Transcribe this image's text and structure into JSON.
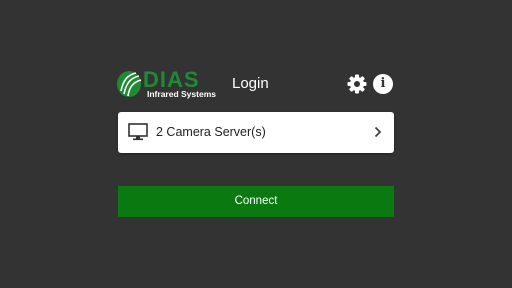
{
  "header": {
    "brand_name": "DIAS",
    "brand_tagline": "Infrared Systems",
    "title": "Login",
    "settings_icon": "gear-icon",
    "info_icon": "info-icon",
    "info_glyph": "i"
  },
  "server_selector": {
    "icon": "monitor-icon",
    "label": "2 Camera Server(s)",
    "chevron_icon": "chevron-right-icon"
  },
  "actions": {
    "connect_label": "Connect"
  },
  "colors": {
    "background": "#333333",
    "brand_green": "#1e8a34",
    "connect_green": "#0a7a10",
    "row_background": "#ffffff"
  }
}
